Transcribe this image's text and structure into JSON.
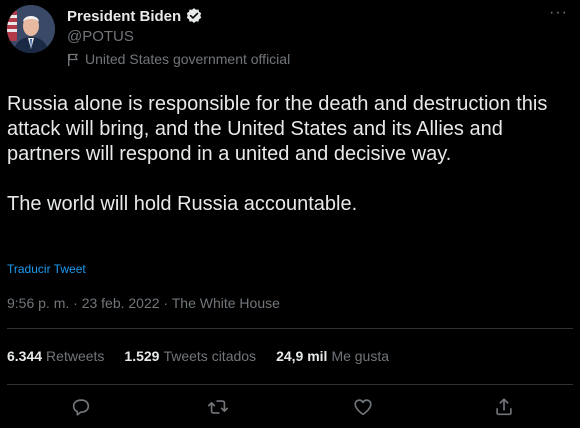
{
  "author": {
    "name": "President Biden",
    "handle": "@POTUS",
    "label": "United States government official"
  },
  "tweet": {
    "paragraphs": [
      "Russia alone is responsible for the death and destruction this attack will bring, and the United States and its Allies and partners will respond in a united and decisive way.",
      "The world will hold Russia accountable."
    ],
    "translate_label": "Traducir Tweet",
    "meta": "9:56 p. m. · 23 feb. 2022 · The White House"
  },
  "stats": {
    "retweets_count": "6.344",
    "retweets_label": "Retweets",
    "quotes_count": "1.529",
    "quotes_label": "Tweets citados",
    "likes_count": "24,9 mil",
    "likes_label": "Me gusta"
  },
  "colors": {
    "background": "#000000",
    "text": "#e7e9ea",
    "muted": "#71767b",
    "accent": "#1d9bf0",
    "divider": "#2f3336"
  },
  "icons": {
    "verified": "verified-badge-icon",
    "flag": "flag-icon",
    "more": "more-icon",
    "reply": "reply-icon",
    "retweet": "retweet-icon",
    "like": "heart-icon",
    "share": "share-icon"
  }
}
